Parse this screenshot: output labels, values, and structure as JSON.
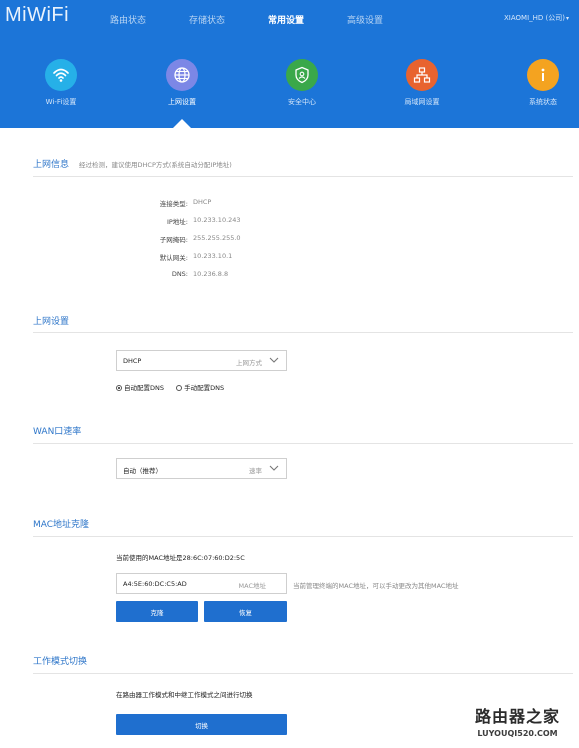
{
  "header": {
    "logo": "MiWiFi",
    "nav": [
      "路由状态",
      "存储状态",
      "常用设置",
      "高级设置"
    ],
    "nav_active_index": 2,
    "user": "XIAOMI_HD (公司)"
  },
  "tiles": [
    {
      "label": "Wi-Fi设置",
      "icon": "wifi-icon",
      "color": "#26b0e8"
    },
    {
      "label": "上网设置",
      "icon": "globe-icon",
      "color": "#7c87e6",
      "active": true
    },
    {
      "label": "安全中心",
      "icon": "shield-icon",
      "color": "#3aa84a"
    },
    {
      "label": "局域网设置",
      "icon": "network-icon",
      "color": "#e8632f"
    },
    {
      "label": "系统状态",
      "icon": "info-icon",
      "color": "#f4a320"
    }
  ],
  "internet_info": {
    "title": "上网信息",
    "desc": "经过检测，建议使用DHCP方式(系统自动分配IP地址)",
    "rows": [
      {
        "label": "连接类型:",
        "value": "DHCP"
      },
      {
        "label": "IP地址:",
        "value": "10.233.10.243"
      },
      {
        "label": "子网掩码:",
        "value": "255.255.255.0"
      },
      {
        "label": "默认网关:",
        "value": "10.233.10.1"
      },
      {
        "label": "DNS:",
        "value": "10.236.8.8"
      }
    ]
  },
  "internet_settings": {
    "title": "上网设置",
    "mode_value": "DHCP",
    "mode_hint": "上网方式",
    "dns_auto": "自动配置DNS",
    "dns_manual": "手动配置DNS"
  },
  "wan_speed": {
    "title": "WAN口速率",
    "value": "自动（推荐）",
    "hint": "速率"
  },
  "mac_clone": {
    "title": "MAC地址克隆",
    "current": "当前使用的MAC地址是28:6C:07:60:D2:5C",
    "input_value": "A4:5E:60:DC:C5:AD",
    "input_hint": "MAC地址",
    "note": "当前管理终端的MAC地址，可以手动更改为其他MAC地址",
    "clone_label": "克隆",
    "restore_label": "恢复"
  },
  "work_mode": {
    "title": "工作模式切换",
    "desc": "在路由器工作模式和中继工作模式之间进行切换",
    "switch_label": "切换"
  },
  "watermark": {
    "cn": "路由器之家",
    "en": "LUYOUQI520.COM"
  }
}
